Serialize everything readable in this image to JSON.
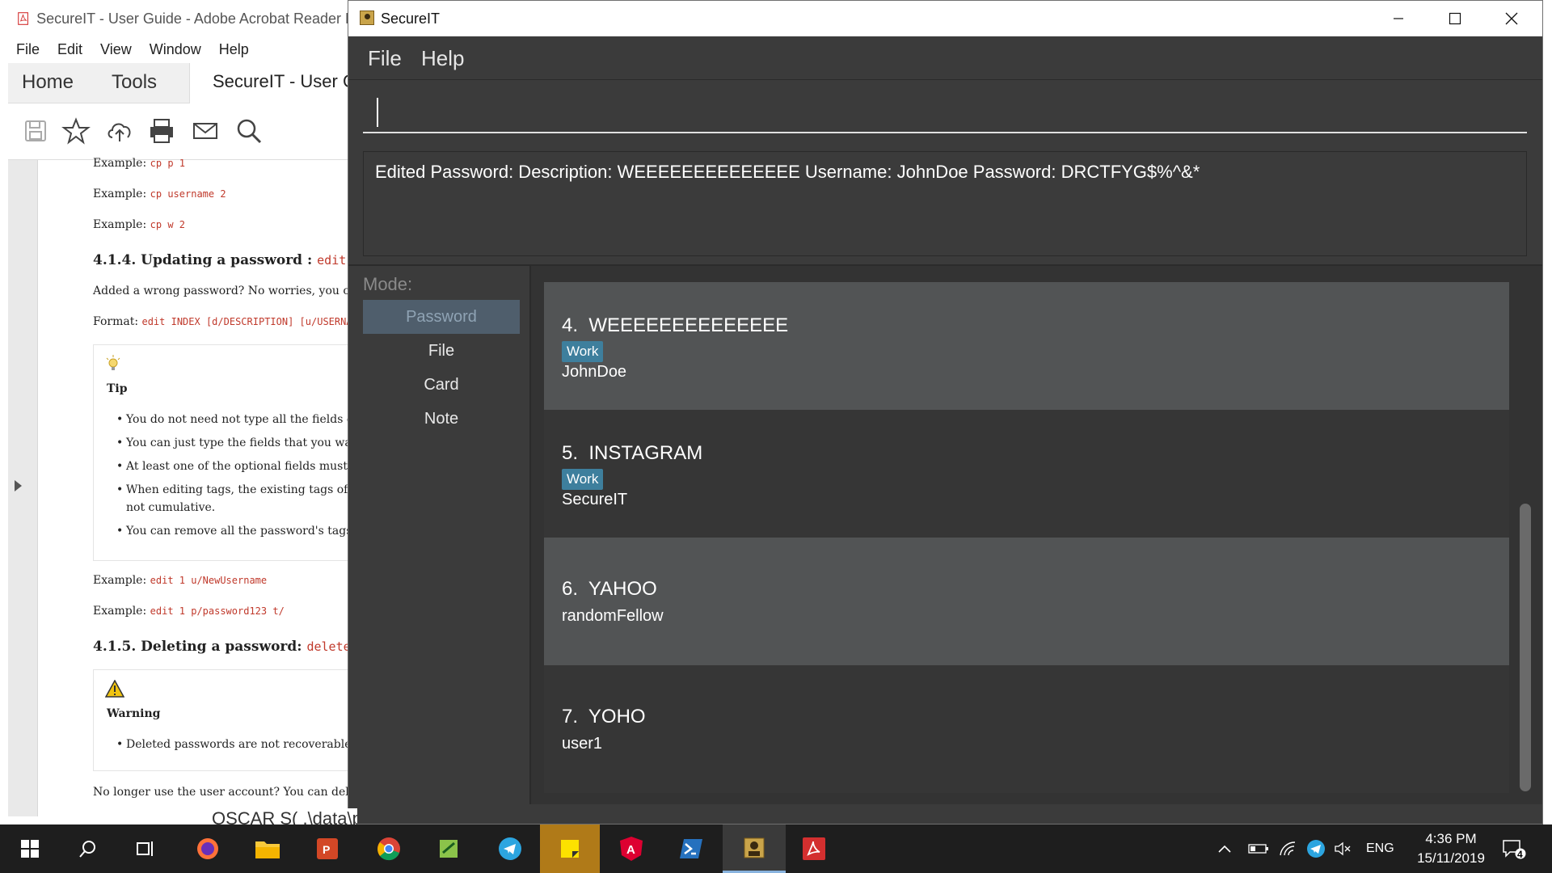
{
  "acrobat": {
    "window_title": "SecureIT - User Guide - Adobe Acrobat Reader D",
    "menu": [
      "File",
      "Edit",
      "View",
      "Window",
      "Help"
    ],
    "tabs": {
      "home": "Home",
      "tools": "Tools",
      "doc": "SecureIT - User G"
    },
    "content": {
      "ex1_prefix": "Example: ",
      "ex1_code": "cp p 1",
      "ex2_prefix": "Example: ",
      "ex2_code": "cp username 2",
      "ex3_prefix": "Example: ",
      "ex3_code": "cp w 2",
      "h414": "4.1.4. Updating a password : ",
      "h414_code": "edit",
      "p1": "Added a wrong password? No worries, you can e",
      "format_prefix": "Format: ",
      "format_code": "edit INDEX [d/DESCRIPTION] [u/USERNAME",
      "tip_title": "Tip",
      "tip_bullets": [
        "You do not need not type all the fields of th",
        "You can just type the fields that you want t",
        "At least one of the optional fields must be p",
        "When editing tags, the existing tags of the",
        "not cumulative.",
        "You can remove all the password's tags by"
      ],
      "ex4_prefix": "Example: ",
      "ex4_code": "edit 1 u/NewUsername",
      "ex5_prefix": "Example: ",
      "ex5_code": "edit 1 p/password123 t/",
      "h415": "4.1.5. Deleting a password: ",
      "h415_code": "delete",
      "warning_title": "Warning",
      "warning_bullet": "Deleted passwords are not recoverable",
      "p2": "No longer use the user account? You can delete t",
      "bottom_text": "OSCAR S( .\\data\\passwordbook.json"
    }
  },
  "secureit": {
    "window_title": "SecureIT",
    "menu": {
      "file": "File",
      "help": "Help"
    },
    "command_input": {
      "value": "",
      "placeholder": ""
    },
    "result_text": "Edited Password: Description: WEEEEEEEEEEEEEE Username: JohnDoe Password: DRCTFYG$%^&*",
    "mode_label": "Mode:",
    "modes": [
      "Password",
      "File",
      "Card",
      "Note"
    ],
    "active_mode": "Password",
    "passwords": [
      {
        "index": "4.",
        "description": "WEEEEEEEEEEEEEE",
        "tag": "Work",
        "username": "JohnDoe"
      },
      {
        "index": "5.",
        "description": "INSTAGRAM",
        "tag": "Work",
        "username": "SecureIT"
      },
      {
        "index": "6.",
        "description": "YAHOO",
        "tag": "",
        "username": "randomFellow"
      },
      {
        "index": "7.",
        "description": "YOHO",
        "tag": "",
        "username": "user1"
      }
    ]
  },
  "taskbar": {
    "tray": {
      "language": "ENG",
      "notifications": "4"
    },
    "clock": {
      "time": "4:36 PM",
      "date": "15/11/2019"
    }
  },
  "colors": {
    "secureit_bg": "#3b3b3b",
    "card_light": "#525455",
    "card_dark": "#363636",
    "tag_bg": "#3e7f9d",
    "active_mode_bg": "#4f5e6c",
    "code_red": "#c0392b",
    "taskbar_bg": "#1e1e1e"
  }
}
